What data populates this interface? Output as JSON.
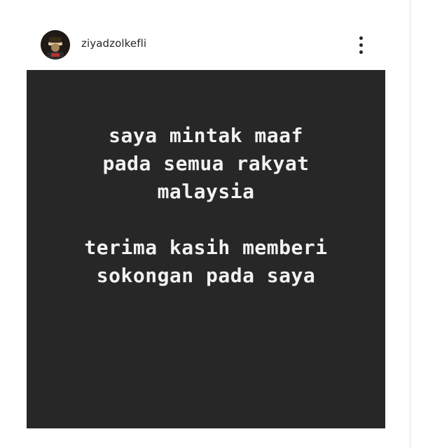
{
  "post": {
    "username": "ziyadzolkefli",
    "avatar": "profile-avatar",
    "more_icon": "more-options-vertical-icon",
    "image_background": "#272727",
    "image_text_color": "#f2f2f2",
    "image_text": {
      "line1": "saya mintak maaf",
      "line2": "pada semua rakyat",
      "line3": "malaysia",
      "line4": "",
      "line5": "terima kasih memberi",
      "line6": "sokongan pada saya"
    }
  }
}
